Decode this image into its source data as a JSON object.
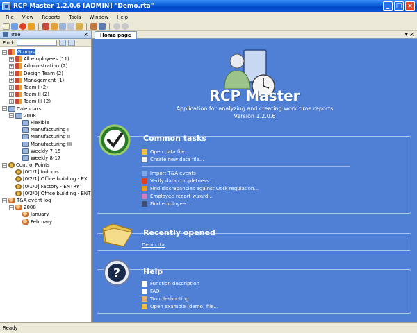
{
  "window": {
    "title": "RCP Master 1.2.0.6  [ADMIN] \"Demo.rta\""
  },
  "menu": [
    "File",
    "View",
    "Reports",
    "Tools",
    "Window",
    "Help"
  ],
  "tree_panel": {
    "title": "Tree",
    "find_label": "Find:",
    "nodes": [
      {
        "label": "Groups",
        "level": 0,
        "icon": "group-icon",
        "expander": "-",
        "selected": true
      },
      {
        "label": "All employees (11)",
        "level": 1,
        "icon": "group-icon",
        "expander": "+"
      },
      {
        "label": "Administration (2)",
        "level": 1,
        "icon": "group-icon",
        "expander": "+"
      },
      {
        "label": "Design Team (2)",
        "level": 1,
        "icon": "group-icon",
        "expander": "+"
      },
      {
        "label": "Management (1)",
        "level": 1,
        "icon": "group-icon",
        "expander": "+"
      },
      {
        "label": "Team I (2)",
        "level": 1,
        "icon": "group-icon",
        "expander": "+"
      },
      {
        "label": "Team II (2)",
        "level": 1,
        "icon": "group-icon",
        "expander": "+"
      },
      {
        "label": "Team III (2)",
        "level": 1,
        "icon": "group-icon",
        "expander": "+"
      },
      {
        "label": "Calendars",
        "level": 0,
        "icon": "calendar-icon",
        "expander": "-"
      },
      {
        "label": "2008",
        "level": 1,
        "icon": "calendar-icon",
        "expander": "-"
      },
      {
        "label": "Flexible",
        "level": 2,
        "icon": "calendar-icon",
        "expander": ""
      },
      {
        "label": "Manufacturing I",
        "level": 2,
        "icon": "calendar-icon",
        "expander": ""
      },
      {
        "label": "Manufacturing II",
        "level": 2,
        "icon": "calendar-icon",
        "expander": ""
      },
      {
        "label": "Manufacturing III",
        "level": 2,
        "icon": "calendar-icon",
        "expander": ""
      },
      {
        "label": "Weekly 7-15",
        "level": 2,
        "icon": "calendar-icon",
        "expander": ""
      },
      {
        "label": "Weekly 8-17",
        "level": 2,
        "icon": "calendar-icon",
        "expander": ""
      },
      {
        "label": "Control Points",
        "level": 0,
        "icon": "control-point-icon",
        "expander": "-"
      },
      {
        "label": "[0/1/1] Indoors",
        "level": 1,
        "icon": "control-point-icon",
        "expander": ""
      },
      {
        "label": "[0/2/1] Office building - EXI",
        "level": 1,
        "icon": "control-point-icon",
        "expander": ""
      },
      {
        "label": "[0/1/0] Factory - ENTRY",
        "level": 1,
        "icon": "control-point-icon",
        "expander": ""
      },
      {
        "label": "[0/2/0] Office building - ENT",
        "level": 1,
        "icon": "control-point-icon",
        "expander": ""
      },
      {
        "label": "T&A event log",
        "level": 0,
        "icon": "event-log-icon",
        "expander": "-"
      },
      {
        "label": "2008",
        "level": 1,
        "icon": "event-log-icon",
        "expander": "-"
      },
      {
        "label": "January",
        "level": 2,
        "icon": "event-log-icon",
        "expander": ""
      },
      {
        "label": "February",
        "level": 2,
        "icon": "event-log-icon",
        "expander": ""
      }
    ]
  },
  "tab": {
    "label": "Home page"
  },
  "home": {
    "title": "RCP Master",
    "subtitle": "Application for analyzing and creating work time reports",
    "version": "Version 1.2.0.6",
    "common_tasks": {
      "title": "Common tasks",
      "group1": [
        {
          "label": "Open data file...",
          "icon": "open-folder-icon",
          "color": "#f0c24a"
        },
        {
          "label": "Create new data file...",
          "icon": "new-file-icon",
          "color": "#f5f5f5"
        }
      ],
      "group2": [
        {
          "label": "Import T&A events",
          "icon": "import-icon",
          "color": "#7ea6e8"
        },
        {
          "label": "Verify data completness...",
          "icon": "verify-icon",
          "color": "#e04020"
        },
        {
          "label": "Find discrepancies against work regulation...",
          "icon": "discrepancy-icon",
          "color": "#e8a020"
        },
        {
          "label": "Employee report wizard...",
          "icon": "wizard-icon",
          "color": "#d080c0"
        },
        {
          "label": "Find employee...",
          "icon": "find-employee-icon",
          "color": "#405070"
        }
      ]
    },
    "recently_opened": {
      "title": "Recently opened",
      "items": [
        "Demo.rta"
      ]
    },
    "help": {
      "title": "Help",
      "items": [
        {
          "label": "Function description",
          "icon": "info-icon",
          "color": "#ffffff"
        },
        {
          "label": "FAQ",
          "icon": "question-icon",
          "color": "#ffffff"
        },
        {
          "label": "Troubleshooting",
          "icon": "troubleshoot-icon",
          "color": "#e8b070"
        },
        {
          "label": "Open example (demo) file...",
          "icon": "open-folder-icon",
          "color": "#f0c24a"
        }
      ]
    }
  },
  "status": {
    "text": "Ready"
  },
  "colors": {
    "content_bg": "#4f80d6",
    "titlebar": "#0a5bd6",
    "selection": "#316ac5"
  }
}
